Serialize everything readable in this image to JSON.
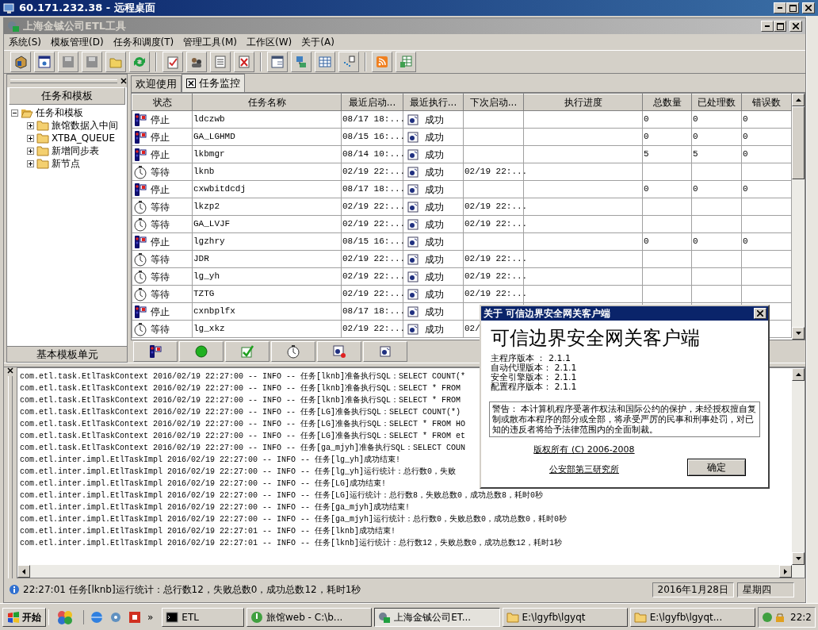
{
  "remote_window": {
    "title": "60.171.232.38 - 远程桌面"
  },
  "app": {
    "title": "上海金铖公司ETL工具"
  },
  "menu": [
    "系统(S)",
    "模板管理(D)",
    "任务和调度(T)",
    "管理工具(M)",
    "工作区(W)",
    "关于(A)"
  ],
  "toolbar": [
    [
      {
        "disabled": false
      },
      {
        "disabled": false
      },
      {
        "disabled": true
      },
      {
        "disabled": true
      },
      {
        "disabled": false
      },
      {
        "disabled": false
      }
    ],
    [
      {
        "disabled": false
      },
      {
        "disabled": false
      },
      {
        "disabled": false
      },
      {
        "disabled": false
      }
    ],
    [
      {
        "disabled": false
      },
      {
        "disabled": false
      },
      {
        "disabled": false
      },
      {
        "disabled": false
      }
    ],
    [
      {
        "disabled": false
      },
      {
        "disabled": false
      }
    ]
  ],
  "left_panel": {
    "title": "任务和模板",
    "tree": [
      {
        "label": "任务和模板",
        "expanded": true,
        "children": [
          {
            "label": "旅馆数据入中间",
            "expanded": false
          },
          {
            "label": "XTBA_QUEUE",
            "expanded": false
          },
          {
            "label": "新增同步表",
            "expanded": false
          },
          {
            "label": "新节点",
            "expanded": false
          }
        ]
      }
    ],
    "footer": "基本模板单元"
  },
  "tabs": [
    {
      "label": "欢迎使用",
      "selected": false,
      "closable": false
    },
    {
      "label": "任务监控",
      "selected": true,
      "closable": true
    }
  ],
  "table": {
    "columns": [
      "状态",
      "任务名称",
      "最近启动...",
      "最近执行...",
      "下次启动...",
      "执行进度",
      "总数量",
      "已处理数",
      "错误数"
    ],
    "rows": [
      {
        "kind": "stopped",
        "status": "停止",
        "name": "ldczwb",
        "last_start": "08/17 18:...",
        "last_result": "成功",
        "total": "0",
        "processed": "0",
        "errors": "0"
      },
      {
        "kind": "stopped",
        "status": "停止",
        "name": "GA_LGHMD",
        "last_start": "08/15 16:...",
        "last_result": "成功",
        "total": "0",
        "processed": "0",
        "errors": "0"
      },
      {
        "kind": "stopped",
        "status": "停止",
        "name": "lkbmgr",
        "last_start": "08/14 10:...",
        "last_result": "成功",
        "total": "5",
        "processed": "5",
        "errors": "0"
      },
      {
        "kind": "waiting",
        "status": "等待",
        "name": "lknb",
        "last_start": "02/19 22:...",
        "last_result": "成功",
        "next_start": "02/19 22:..."
      },
      {
        "kind": "stopped",
        "status": "停止",
        "name": "cxwbitdcdj",
        "last_start": "08/17 18:...",
        "last_result": "成功",
        "total": "0",
        "processed": "0",
        "errors": "0"
      },
      {
        "kind": "waiting",
        "status": "等待",
        "name": "lkzp2",
        "last_start": "02/19 22:...",
        "last_result": "成功",
        "next_start": "02/19 22:..."
      },
      {
        "kind": "waiting",
        "status": "等待",
        "name": "GA_LVJF",
        "last_start": "02/19 22:...",
        "last_result": "成功",
        "next_start": "02/19 22:..."
      },
      {
        "kind": "stopped",
        "status": "停止",
        "name": "lgzhry",
        "last_start": "08/15 16:...",
        "last_result": "成功",
        "total": "0",
        "processed": "0",
        "errors": "0"
      },
      {
        "kind": "waiting",
        "status": "等待",
        "name": "JDR",
        "last_start": "02/19 22:...",
        "last_result": "成功",
        "next_start": "02/19 22:..."
      },
      {
        "kind": "waiting",
        "status": "等待",
        "name": "lg_yh",
        "last_start": "02/19 22:...",
        "last_result": "成功",
        "next_start": "02/19 22:..."
      },
      {
        "kind": "waiting",
        "status": "等待",
        "name": "TZTG",
        "last_start": "02/19 22:...",
        "last_result": "成功",
        "next_start": "02/19 22:..."
      },
      {
        "kind": "stopped",
        "status": "停止",
        "name": "cxnbplfx",
        "last_start": "08/17 18:...",
        "last_result": "成功"
      },
      {
        "kind": "waiting",
        "status": "等待",
        "name": "lg_xkz",
        "last_start": "02/19 22:...",
        "last_result": "成功",
        "next_start": "02/"
      }
    ]
  },
  "log": {
    "lines": [
      "com.etl.task.EtlTaskContext 2016/02/19 22:27:00 -- INFO -- 任务[lknb]准备执行SQL：SELECT COUNT(*",
      "com.etl.task.EtlTaskContext 2016/02/19 22:27:00 -- INFO -- 任务[lknb]准备执行SQL：SELECT * FROM",
      "com.etl.task.EtlTaskContext 2016/02/19 22:27:00 -- INFO -- 任务[lknb]准备执行SQL：SELECT * FROM",
      "com.etl.task.EtlTaskContext 2016/02/19 22:27:00 -- INFO -- 任务[LG]准备执行SQL：SELECT COUNT(*)",
      "com.etl.task.EtlTaskContext 2016/02/19 22:27:00 -- INFO -- 任务[LG]准备执行SQL：SELECT * FROM HO",
      "com.etl.task.EtlTaskContext 2016/02/19 22:27:00 -- INFO -- 任务[LG]准备执行SQL：SELECT * FROM et",
      "com.etl.task.EtlTaskContext 2016/02/19 22:27:00 -- INFO -- 任务[ga_mjyh]准备执行SQL：SELECT COUN",
      "com.etl.inter.impl.EtlTaskImpl 2016/02/19 22:27:00 -- INFO -- 任务[lg_yh]成功结束!",
      "com.etl.inter.impl.EtlTaskImpl 2016/02/19 22:27:00 -- INFO -- 任务[lg_yh]运行统计：总行数0，失败",
      "com.etl.inter.impl.EtlTaskImpl 2016/02/19 22:27:00 -- INFO -- 任务[LG]成功结束!",
      "com.etl.inter.impl.EtlTaskImpl 2016/02/19 22:27:00 -- INFO -- 任务[LG]运行统计：总行数8，失败总数0，成功总数8，耗时0秒",
      "com.etl.inter.impl.EtlTaskImpl 2016/02/19 22:27:00 -- INFO -- 任务[ga_mjyh]成功结束!",
      "com.etl.inter.impl.EtlTaskImpl 2016/02/19 22:27:00 -- INFO -- 任务[ga_mjyh]运行统计：总行数0，失败总数0，成功总数0，耗时0秒",
      "com.etl.inter.impl.EtlTaskImpl 2016/02/19 22:27:01 -- INFO -- 任务[lknb]成功结束!",
      "com.etl.inter.impl.EtlTaskImpl 2016/02/19 22:27:01 -- INFO -- 任务[lknb]运行统计：总行数12，失败总数0，成功总数12，耗时1秒"
    ]
  },
  "status_bar": {
    "message": "22:27:01 任务[lknb]运行统计：总行数12，失败总数0，成功总数12，耗时1秒",
    "date": "2016年1月28日",
    "weekday": "星期四"
  },
  "about_dialog": {
    "title": "关于 可信边界安全网关客户端",
    "heading": "可信边界安全网关客户端",
    "versions": [
      "主程序版本 ： 2.1.1",
      "自动代理版本： 2.1.1",
      "安全引擎版本： 2.1.1",
      "配置程序版本： 2.1.1"
    ],
    "warning": "警告： 本计算机程序受著作权法和国际公约的保护，未经授权擅自复制或散布本程序的部分或全部，将承受严厉的民事和刑事处罚，对已知的违反者将给予法律范围内的全面制裁。",
    "copyright": "版权所有 (C) 2006-2008",
    "organization": "公安部第三研究所",
    "ok_button": "确定"
  },
  "taskbar": {
    "start": "开始",
    "more": "»",
    "tasks": [
      {
        "label": "ETL",
        "selected": false
      },
      {
        "label": "旅馆web - C:\\b...",
        "selected": false
      },
      {
        "label": "上海金铖公司ET...",
        "selected": true
      },
      {
        "label": "E:\\lgyfb\\lgyqt",
        "selected": false
      },
      {
        "label": "E:\\lgyfb\\lgyqt...",
        "selected": false
      }
    ],
    "clock": "22:2"
  }
}
